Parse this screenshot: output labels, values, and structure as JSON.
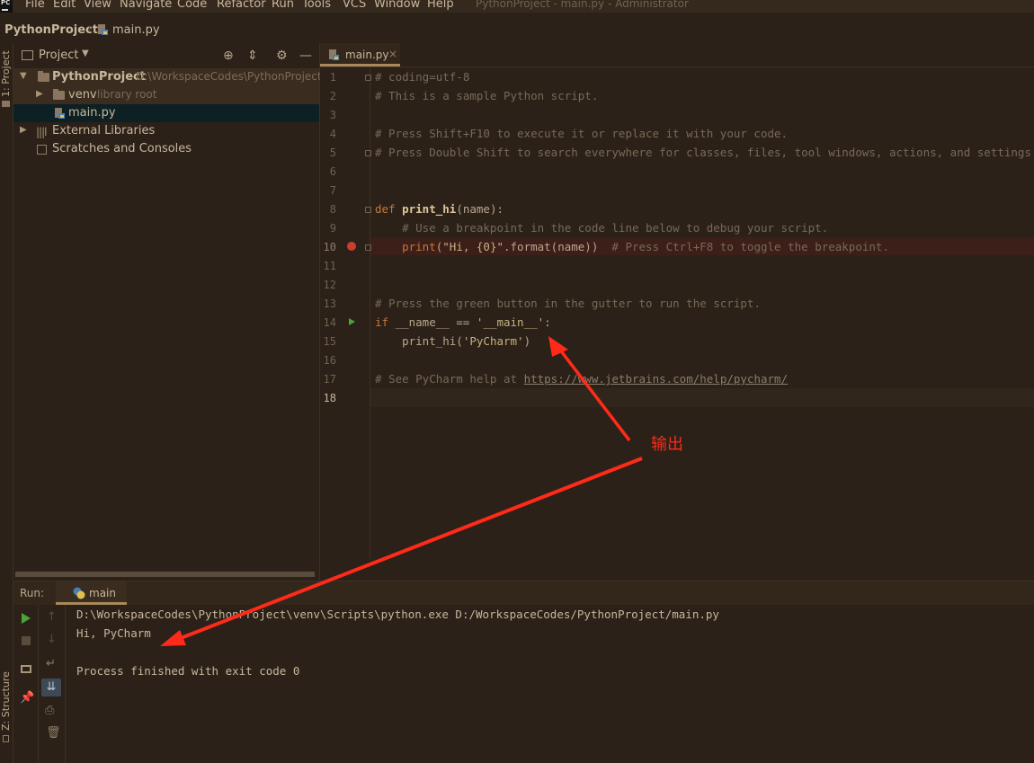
{
  "menu": {
    "items": [
      "File",
      "Edit",
      "View",
      "Navigate",
      "Code",
      "Refactor",
      "Run",
      "Tools",
      "VCS",
      "Window",
      "Help"
    ],
    "window_title": "PythonProject - main.py - Administrator"
  },
  "navbar": {
    "project": "PythonProject",
    "file": "main.py"
  },
  "left_strip": {
    "project_tab": "1: Project",
    "structure_tab": "Z: Structure"
  },
  "project_panel": {
    "title": "Project",
    "tree": {
      "root_label": "PythonProject",
      "root_path": "D:\\WorkspaceCodes\\PythonProject",
      "venv_label": "venv",
      "venv_note": "library root",
      "file_label": "main.py",
      "external_label": "External Libraries",
      "scratches_label": "Scratches and Consoles"
    }
  },
  "editor": {
    "tab_label": "main.py",
    "line_numbers": [
      "1",
      "2",
      "3",
      "4",
      "5",
      "6",
      "7",
      "8",
      "9",
      "10",
      "11",
      "12",
      "13",
      "14",
      "15",
      "16",
      "17",
      "18"
    ],
    "code": {
      "l1": "# coding=utf-8",
      "l2": "# This is a sample Python script.",
      "l4": "# Press Shift+F10 to execute it or replace it with your code.",
      "l5": "# Press Double Shift to search everywhere for classes, files, tool windows, actions, and settings.",
      "l8_kw": "def ",
      "l8_fn": "print_hi",
      "l8_rest": "(name):",
      "l9": "    # Use a breakpoint in the code line below to debug your script.",
      "l10_fn": "    print",
      "l10_a": "(",
      "l10_str": "\"Hi, {0}\"",
      "l10_b": ".format(name))  ",
      "l10_com": "# Press Ctrl+F8 to toggle the breakpoint.",
      "l13": "# Press the green button in the gutter to run the script.",
      "l14_kw": "if ",
      "l14_a": "__name__ == ",
      "l14_str": "'__main__'",
      "l14_b": ":",
      "l15_a": "    print_hi(",
      "l15_str": "'PyCharm'",
      "l15_b": ")",
      "l17_com": "# See PyCharm help at ",
      "l17_url": "https://www.jetbrains.com/help/pycharm/"
    }
  },
  "run_panel": {
    "label": "Run:",
    "tab_label": "main",
    "console": [
      "D:\\WorkspaceCodes\\PythonProject\\venv\\Scripts\\python.exe D:/WorkspaceCodes/PythonProject/main.py",
      "Hi, PyCharm",
      "",
      "Process finished with exit code 0"
    ]
  },
  "annotation": {
    "text": "输出",
    "color": "#ff2a1a"
  }
}
